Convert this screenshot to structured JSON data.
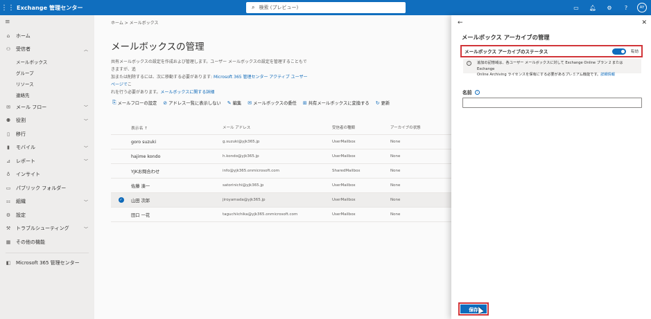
{
  "topbar": {
    "app_title": "Exchange 管理センター",
    "search_placeholder": "検索 (プレビュー)",
    "avatar_initials": "AY"
  },
  "sidebar": {
    "items": [
      {
        "label": "ホーム",
        "icon": "home-icon"
      },
      {
        "label": "受信者",
        "icon": "person-icon",
        "expanded": true
      },
      {
        "label": "メールボックス",
        "sub": true
      },
      {
        "label": "グループ",
        "sub": true
      },
      {
        "label": "リソース",
        "sub": true
      },
      {
        "label": "連絡先",
        "sub": true
      },
      {
        "label": "メール フロー",
        "icon": "mail-icon",
        "chevron": true
      },
      {
        "label": "役割",
        "icon": "roles-icon",
        "chevron": true
      },
      {
        "label": "移行",
        "icon": "migration-icon"
      },
      {
        "label": "モバイル",
        "icon": "mobile-icon",
        "chevron": true
      },
      {
        "label": "レポート",
        "icon": "report-icon",
        "chevron": true
      },
      {
        "label": "インサイト",
        "icon": "lightbulb-icon"
      },
      {
        "label": "パブリック フォルダー",
        "icon": "folder-icon"
      },
      {
        "label": "組織",
        "icon": "org-icon",
        "chevron": true
      },
      {
        "label": "設定",
        "icon": "gear-icon"
      },
      {
        "label": "トラブルシューティング",
        "icon": "wrench-icon",
        "chevron": true
      },
      {
        "label": "その他の機能",
        "icon": "grid-icon"
      }
    ],
    "footer_label": "Microsoft 365 管理センター"
  },
  "main": {
    "breadcrumb": "ホーム  >  メールボックス",
    "title": "メールボックスの管理",
    "desc_line1": "共有メールボックスの設定を作成および管理します。ユーザー メールボックスの設定を管理することもできますが、追",
    "desc_line2a": "加または削除するには、次に移動する必要があります: ",
    "desc_link1": "Microsoft 365 管理センター アクティブ ユーザー ページで",
    "desc_line3a": "こ",
    "desc_line3b": "れを行う必要があります。",
    "desc_link2": "メールボックスに関する詳細",
    "toolbar": [
      {
        "label": "メールフローの設定",
        "icon": "mailflow-icon"
      },
      {
        "label": "アドレス一覧に表示しない",
        "icon": "hide-icon"
      },
      {
        "label": "編集",
        "icon": "edit-icon"
      },
      {
        "label": "メールボックスの委任",
        "icon": "delegate-icon"
      },
      {
        "label": "共有メールボックスに変換する",
        "icon": "convert-icon"
      },
      {
        "label": "更新",
        "icon": "refresh-icon"
      }
    ],
    "columns": [
      "表示名 ↑",
      "メール アドレス",
      "受信者の種類",
      "アーカイブの状態"
    ],
    "rows": [
      [
        "goro suzuki",
        "g.suzuki@yjk365.jp",
        "UserMailbox",
        "None"
      ],
      [
        "hajime kondo",
        "h.kondo@yjk365.jp",
        "UserMailbox",
        "None"
      ],
      [
        "YJKお問合わせ",
        "info@yjk365.onmicrosoft.com",
        "SharedMailbox",
        "None"
      ],
      [
        "佐藤 湊一",
        "satorinichi@yjk365.jp",
        "UserMailbox",
        "None"
      ],
      [
        "山田 次郎",
        "jiroyamada@yjk365.jp",
        "UserMailbox",
        "None"
      ],
      [
        "田口 一花",
        "taguchiichika@yjk365.onmicrosoft.com",
        "UserMailbox",
        "None"
      ]
    ]
  },
  "panel": {
    "title": "メールボックス アーカイブの管理",
    "status_label": "メールボックス アーカイブのステータス",
    "toggle_label": "有効",
    "info_line1": "追加の記憶域は、各ユーザー メールボックスに対して Exchange Online プラン 2 または Exchange",
    "info_line2": "Online Archiving ライセンスを保有にする必要があるプレミアム機能です。",
    "info_link": "詳細情報",
    "name_label": "名前",
    "name_value": "",
    "save_label": "保存"
  },
  "colors": {
    "accent": "#0f6cbd",
    "highlight": "#d13438"
  }
}
